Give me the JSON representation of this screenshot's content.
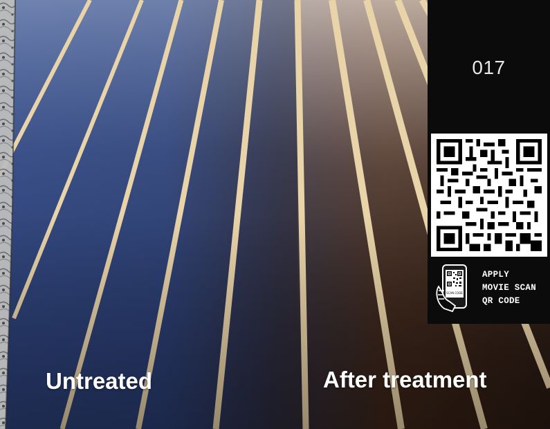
{
  "labels": {
    "left": "Untreated",
    "right": "After treatment"
  },
  "side_panel": {
    "page_number": "017",
    "cta_lines": [
      "APPLY",
      "MOVIE SCAN",
      "QR CODE"
    ],
    "phone_screen_text": "SCAN CODE"
  },
  "colors": {
    "panel_bg": "#0b0b0b",
    "floor_blue": "#2a3f73",
    "floor_brown": "#3a2418",
    "stripe": "#e7cfa4"
  },
  "icons": [
    "qr-code-icon",
    "phone-scan-icon"
  ]
}
